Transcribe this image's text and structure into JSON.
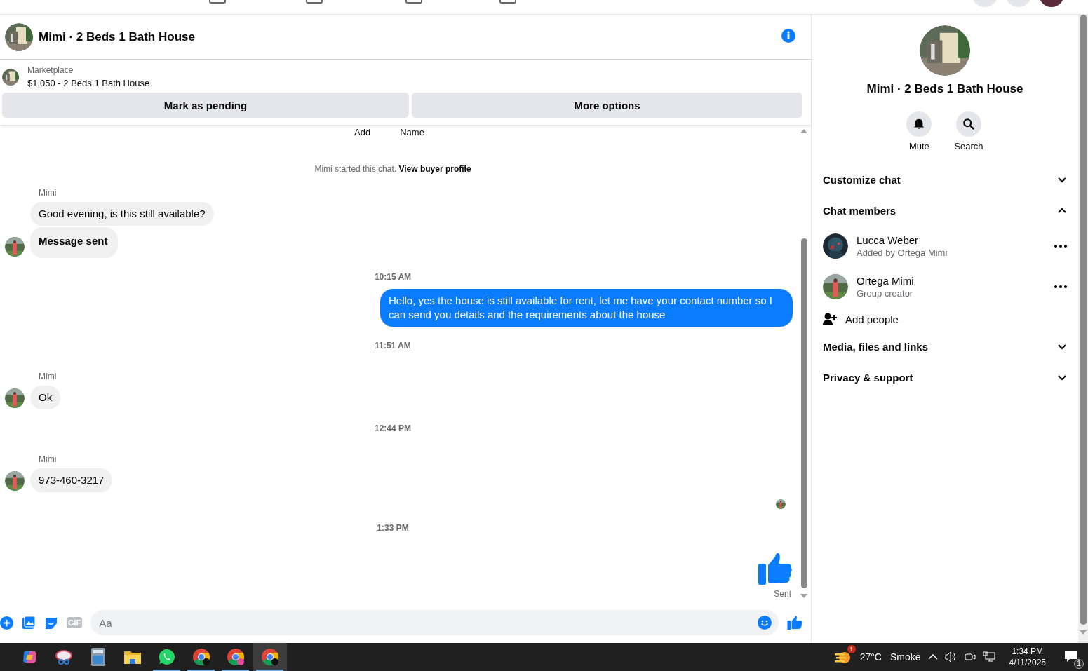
{
  "header": {
    "title": "Mimi · 2 Beds 1 Bath House"
  },
  "listing": {
    "source": "Marketplace",
    "title": "$1,050 - 2 Beds 1 Bath House",
    "buttons": [
      "Mark as pending",
      "More options"
    ]
  },
  "cut_row": [
    "Add",
    "Name"
  ],
  "messages": [
    {
      "kind": "system",
      "text": "Mimi started this chat.",
      "link": "View buyer profile"
    },
    {
      "kind": "incoming",
      "sender": "Mimi",
      "bubbles": [
        {
          "text": "Good evening, is this still available?",
          "bold": false
        },
        {
          "text": "Message sent",
          "bold": true
        }
      ]
    },
    {
      "kind": "time",
      "text": "10:15 AM"
    },
    {
      "kind": "outgoing",
      "text": "Hello, yes the house is still available for rent, let me have your contact number so I can send you details and the requirements about the house"
    },
    {
      "kind": "time",
      "text": "11:51 AM"
    },
    {
      "kind": "incoming",
      "sender": "Mimi",
      "bubbles": [
        {
          "text": "Ok",
          "bold": false
        }
      ]
    },
    {
      "kind": "time",
      "text": "12:44 PM"
    },
    {
      "kind": "incoming",
      "sender": "Mimi",
      "bubbles": [
        {
          "text": "973-460-3217",
          "bold": false
        }
      ]
    },
    {
      "kind": "seen"
    },
    {
      "kind": "time",
      "text": "1:33 PM"
    },
    {
      "kind": "like",
      "status": "Sent"
    }
  ],
  "composer": {
    "gif": "GIF",
    "placeholder": "Aa"
  },
  "panel": {
    "title": "Mimi · 2 Beds 1 Bath House",
    "actions": [
      {
        "kind": "mute",
        "label": "Mute"
      },
      {
        "kind": "search",
        "label": "Search"
      }
    ],
    "sections": [
      {
        "label": "Customize chat",
        "expanded": false
      },
      {
        "label": "Chat members",
        "expanded": true,
        "members": [
          {
            "name": "Lucca Weber",
            "note": "Added by Ortega Mimi"
          },
          {
            "name": "Ortega Mimi",
            "note": "Group creator"
          }
        ],
        "add": "Add people"
      },
      {
        "label": "Media, files and links",
        "expanded": false
      },
      {
        "label": "Privacy & support",
        "expanded": false
      }
    ]
  },
  "taskbar": {
    "apps": [
      {
        "kind": "copilot",
        "running": false,
        "selected": false
      },
      {
        "kind": "snip",
        "running": false,
        "selected": false
      },
      {
        "kind": "calculator",
        "running": false,
        "selected": false
      },
      {
        "kind": "folder",
        "running": false,
        "selected": false
      },
      {
        "kind": "whatsapp",
        "running": true,
        "selected": false
      },
      {
        "kind": "chrome",
        "running": true,
        "selected": false
      },
      {
        "kind": "chrome",
        "running": true,
        "selected": false
      },
      {
        "kind": "chrome",
        "running": true,
        "selected": true
      }
    ],
    "weather_badge": "1",
    "temperature": "27°C",
    "condition": "Smoke",
    "time": "1:34 PM",
    "date": "4/11/2025",
    "notifications": "1"
  }
}
